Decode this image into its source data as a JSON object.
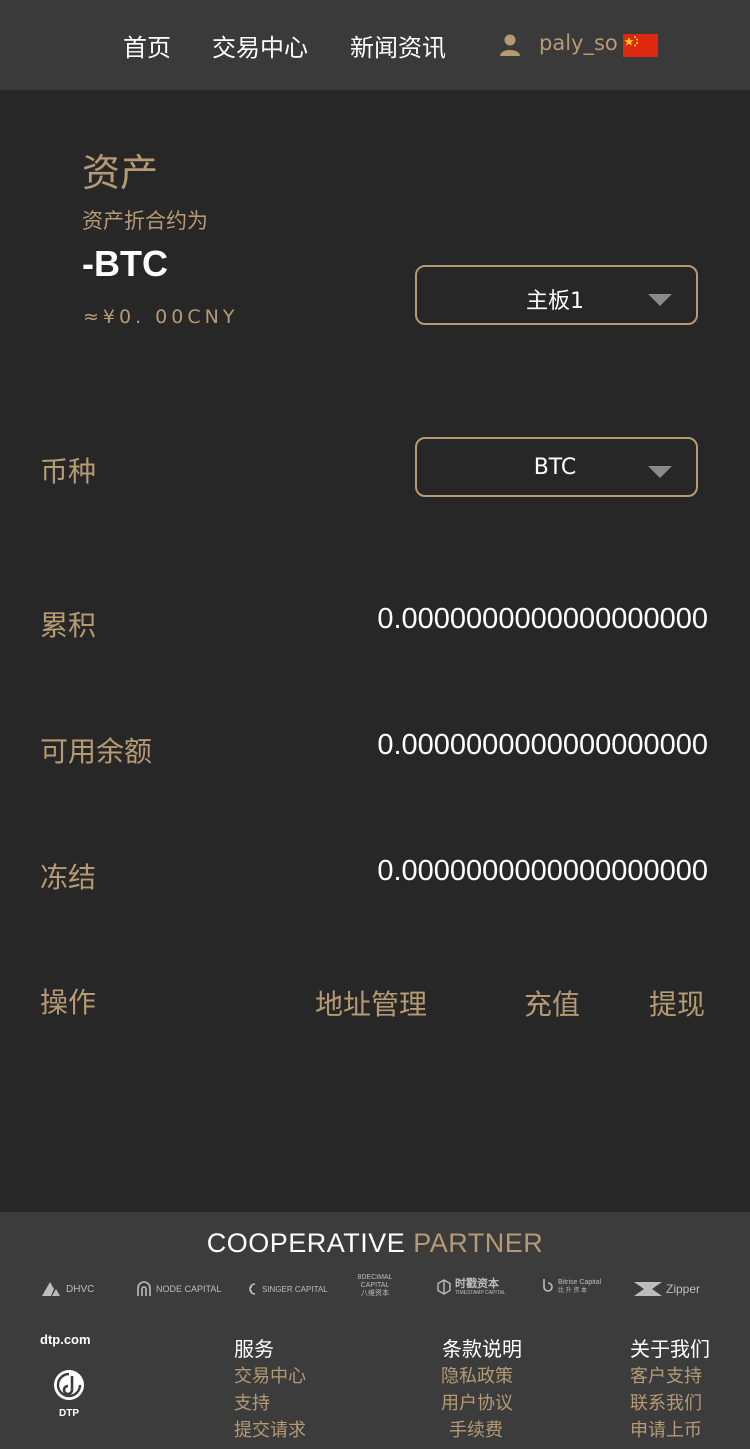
{
  "header": {
    "nav": [
      "首页",
      "交易中心",
      "新闻资讯"
    ],
    "username": "paly_so",
    "flag_icon": "china-flag-icon"
  },
  "asset": {
    "title": "资产",
    "subtitle": "资产折合约为",
    "amount": "-BTC",
    "cny": "≈¥0. 00CNY",
    "board_select": "主板1"
  },
  "currency": {
    "label": "币种",
    "select": "BTC"
  },
  "rows": [
    {
      "label": "累积",
      "value": "0.0000000000000000000"
    },
    {
      "label": "可用余额",
      "value": "0.0000000000000000000"
    },
    {
      "label": "冻结",
      "value": "0.0000000000000000000"
    }
  ],
  "actions": {
    "label": "操作",
    "address": "地址管理",
    "deposit": "充值",
    "withdraw": "提现"
  },
  "footer": {
    "coop_left": "COOPERATIVE",
    "coop_right": "PARTNER",
    "partners": [
      "DHVC",
      "NODE CAPITAL",
      "SINGER CAPITAL",
      "8DECIMAL",
      "时戳资本",
      "Bitrise Capital",
      "Zipper"
    ],
    "partner_extra": {
      "decimal_top": "CAPITAL",
      "decimal_sub": "八维资本",
      "timestamp_sub": "TIMESTAMP CAPITAL",
      "bitrise_sub": "比 升 资 本"
    },
    "brand": "dtp.com",
    "brand_logo_text": "DTP",
    "columns": [
      {
        "title": "服务",
        "links": [
          "交易中心",
          "支持",
          "提交请求"
        ]
      },
      {
        "title": "条款说明",
        "links": [
          "隐私政策",
          "用户协议",
          "手续费"
        ]
      },
      {
        "title": "关于我们",
        "links": [
          "客户支持",
          "联系我们",
          "申请上币"
        ]
      }
    ]
  },
  "colors": {
    "accent": "#b59a74",
    "background": "#272727",
    "header": "#3a3a3a",
    "footer": "#3c3c3c"
  }
}
